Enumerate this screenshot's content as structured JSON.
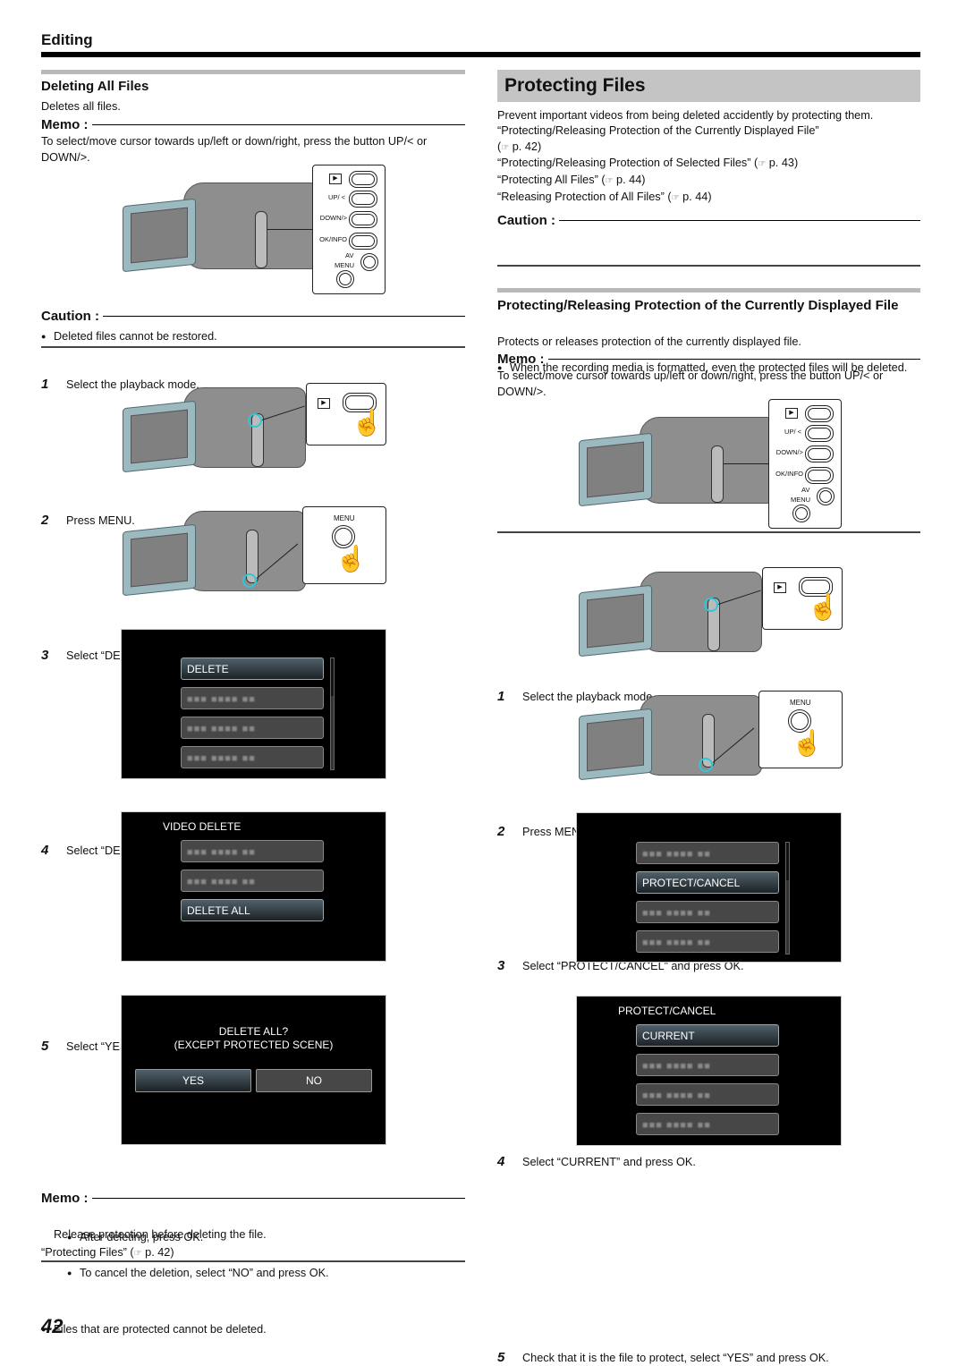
{
  "header": {
    "section": "Editing"
  },
  "left": {
    "title": "Deleting All Files",
    "intro": "Deletes all files.",
    "memo1": {
      "label": "Memo :",
      "text": "To select/move cursor towards up/left or down/right, press the button UP/< or DOWN/>."
    },
    "buttons_diagram": {
      "play": "▶",
      "up": "UP/ <",
      "down": "DOWN/>",
      "ok": "OK/INFO",
      "av": "AV",
      "menu": "MENU"
    },
    "caution": {
      "label": "Caution :",
      "items": [
        "Deleted files cannot be restored."
      ]
    },
    "steps": [
      {
        "num": "1",
        "text": "Select the playback mode."
      },
      {
        "num": "2",
        "text": "Press MENU."
      },
      {
        "num": "3",
        "text": "Select “DELETE” and press OK."
      },
      {
        "num": "4",
        "text": "Select “DELETE ALL” and press OK."
      },
      {
        "num": "5",
        "text": "Select “YES” and press OK."
      }
    ],
    "step1_callout": {
      "play": "▶"
    },
    "step2_callout": {
      "menu": "MENU"
    },
    "screen3": {
      "items": [
        "DELETE",
        "■■■ ■■■■ ■■",
        "■■■ ■■■■ ■■",
        "■■■ ■■■■ ■■"
      ]
    },
    "screen4": {
      "title": "VIDEO DELETE",
      "items": [
        "■■■ ■■■■ ■■",
        "■■■ ■■■■ ■■",
        "DELETE ALL"
      ]
    },
    "screen5": {
      "line1": "DELETE ALL?",
      "line2": "(EXCEPT PROTECTED SCENE)",
      "yes": "YES",
      "no": "NO"
    },
    "after_notes": [
      "After deleting, press OK.",
      "To cancel the deletion, select “NO” and press OK."
    ],
    "memo2": {
      "label": "Memo :",
      "items": [
        "Files that are protected cannot be deleted.",
        "Release protection before deleting the file."
      ],
      "ref_text": "“Protecting Files” (",
      "ref_icon": "☞",
      "ref_page": " p. 42)"
    }
  },
  "right": {
    "title": "Protecting Files",
    "intro": "Prevent important videos from being deleted accidently by protecting them.",
    "links": [
      {
        "text": "“Protecting/Releasing Protection of the Currently Displayed File”",
        "page": " p. 42)",
        "newline": true
      },
      {
        "text": "“Protecting/Releasing Protection of Selected Files” (",
        "page": " p. 43)"
      },
      {
        "text": "“Protecting All Files” (",
        "page": " p. 44)"
      },
      {
        "text": "“Releasing Protection of All Files” (",
        "page": " p. 44)"
      }
    ],
    "ref_icon": "☞",
    "caution": {
      "label": "Caution :",
      "items": [
        "When the recording media is formatted, even the protected files will be deleted."
      ]
    },
    "sub": {
      "title": "Protecting/Releasing Protection of the Currently Displayed File",
      "intro": "Protects or releases protection of the currently displayed file.",
      "memo": {
        "label": "Memo :",
        "text": "To select/move cursor towards up/left or down/right, press the button UP/< or DOWN/>."
      },
      "buttons_diagram": {
        "play": "▶",
        "up": "UP/ <",
        "down": "DOWN/>",
        "ok": "OK/INFO",
        "av": "AV",
        "menu": "MENU"
      },
      "steps": [
        {
          "num": "1",
          "text": "Select the playback mode."
        },
        {
          "num": "2",
          "text": "Press MENU."
        },
        {
          "num": "3",
          "text": "Select “PROTECT/CANCEL” and press OK."
        },
        {
          "num": "4",
          "text": "Select “CURRENT” and press OK."
        },
        {
          "num": "5",
          "text": "Check that it is the file to protect, select “YES” and press OK."
        }
      ],
      "step1_callout": {
        "play": "▶"
      },
      "step2_callout": {
        "menu": "MENU"
      },
      "screen3": {
        "items": [
          "■■■ ■■■■ ■■",
          "PROTECT/CANCEL",
          "■■■ ■■■■ ■■",
          "■■■ ■■■■ ■■"
        ]
      },
      "screen4": {
        "title": "PROTECT/CANCEL",
        "items": [
          "CURRENT",
          "■■■ ■■■■ ■■",
          "■■■ ■■■■ ■■",
          "■■■ ■■■■ ■■"
        ]
      }
    }
  },
  "footer": {
    "page_number": "42"
  },
  "colors": {
    "highlight": "#2ec7da",
    "title_bar": "#c4c4c4",
    "rule": "#000000"
  }
}
